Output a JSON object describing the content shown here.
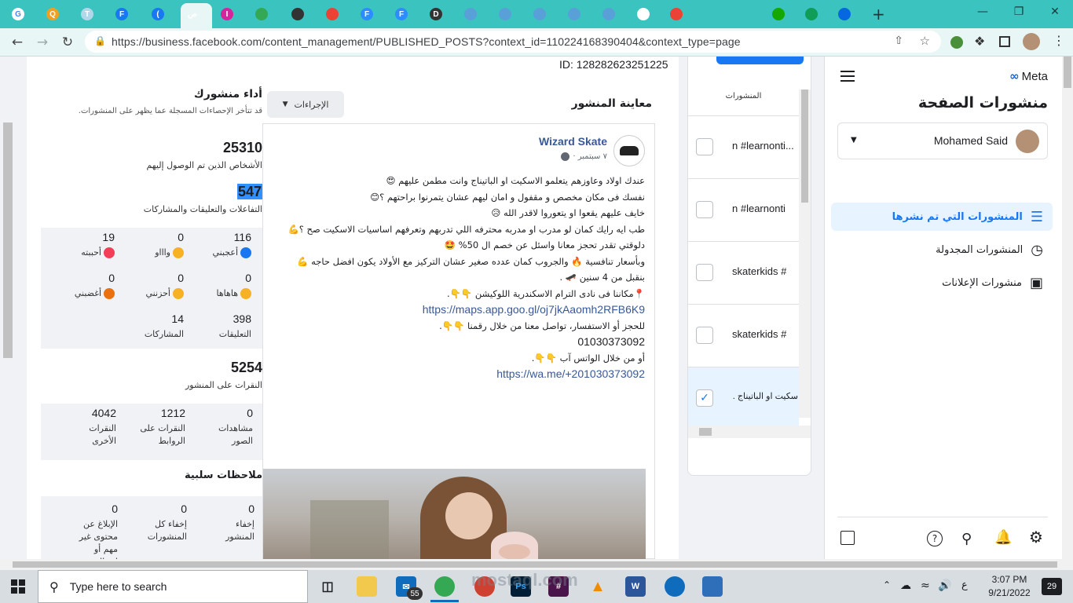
{
  "browser": {
    "tabs": [
      {
        "icon": "google-icon",
        "label": "G",
        "color": "#ffffff"
      },
      {
        "icon": "q-icon",
        "label": "Q",
        "color": "#f0a020"
      },
      {
        "icon": "t-icon",
        "label": "T",
        "color": "#b0d8e8"
      },
      {
        "icon": "facebook-icon",
        "label": "F",
        "color": "#1877f2"
      },
      {
        "icon": "facebook-icon",
        "label": "(",
        "color": "#1877f2"
      },
      {
        "icon": "meta-icon",
        "label": "ص",
        "color": "#e9f6f6"
      },
      {
        "icon": "instagram-icon",
        "label": "I",
        "color": "#d6249f"
      },
      {
        "icon": "play-store-icon",
        "label": "",
        "color": "#34a853"
      },
      {
        "icon": "globe-icon",
        "label": "",
        "color": "#333333"
      },
      {
        "icon": "gmail-icon",
        "label": "",
        "color": "#ea4335"
      },
      {
        "icon": "zoom-icon",
        "label": "F",
        "color": "#2d8cff"
      },
      {
        "icon": "zoom-icon",
        "label": "F",
        "color": "#2d8cff"
      },
      {
        "icon": "download-icon",
        "label": "D",
        "color": "#333333"
      },
      {
        "icon": "circle-icon",
        "label": "",
        "color": "#5aa0d8"
      },
      {
        "icon": "circle-icon",
        "label": "",
        "color": "#5aa0d8"
      },
      {
        "icon": "circle-icon",
        "label": "",
        "color": "#5aa0d8"
      },
      {
        "icon": "circle-icon",
        "label": "",
        "color": "#5aa0d8"
      },
      {
        "icon": "circle-icon",
        "label": "",
        "color": "#5aa0d8"
      },
      {
        "icon": "google-icon",
        "label": "",
        "color": "#ffffff"
      },
      {
        "icon": "gmail-icon",
        "label": "",
        "color": "#ea4335"
      },
      {
        "icon": "bird-icon",
        "label": "",
        "color": "#3bc3c0"
      },
      {
        "icon": "bird-icon",
        "label": "",
        "color": "#3bc3c0"
      },
      {
        "icon": "upwork-icon",
        "label": "",
        "color": "#14a800"
      },
      {
        "icon": "plus-green-icon",
        "label": "",
        "color": "#0f9d58"
      },
      {
        "icon": "meta-icon",
        "label": "",
        "color": "#0668e1"
      }
    ],
    "url": "https://business.facebook.com/content_management/PUBLISHED_POSTS?context_id=110224168390404&context_type=page"
  },
  "sidebar": {
    "brand": "Meta",
    "title": "منشورات الصفحة",
    "account": "Mohamed Said",
    "items": [
      {
        "label": "المنشورات التي تم نشرها",
        "icon": "list-icon",
        "active": true
      },
      {
        "label": "المنشورات المجدولة",
        "icon": "clock-icon",
        "active": false
      },
      {
        "label": "منشورات الإعلانات",
        "icon": "ads-icon",
        "active": false
      }
    ]
  },
  "posts_list": {
    "header": "المنشورات",
    "rows": [
      {
        "text": "n #learnonti...",
        "checked": false
      },
      {
        "text": "n #learnonti",
        "checked": false
      },
      {
        "text": "skaterkids #",
        "checked": false
      },
      {
        "text": "skaterkids #",
        "checked": false
      },
      {
        "text": "سكيت او الباتيناج ...",
        "checked": true
      }
    ]
  },
  "preview": {
    "id_label": "ID: 128282623251225",
    "title": "معاينة المنشور",
    "actions_label": "الإجراءات",
    "page_name": "Wizard Skate",
    "date": "٧ سبتمبر ·",
    "lines": [
      "عندك اولاد وعاوزهم يتعلمو الاسكيت او الباتيناج وانت مطمن عليهم 😍",
      "نفسك فى مكان مخصص و مقفول و امان ليهم عشان يتمرنوا براحتهم ؟😊",
      "خايف عليهم يقعوا او يتعوروا لاقدر الله 😥",
      "طب ايه رايك كمان لو مدرب او مدربه محترفه اللي تدربهم وتعرفهم اساسيات الاسكيت صح ؟💪",
      "دلوقتي تقدر تحجز معانا واسئل عن خصم ال 50% 🤩",
      "وبأسعار تنافسية 🔥 والجروب كمان عدده صغير عشان التركيز مع الأولاد يكون افضل حاجه 💪",
      "بنقبل من 4 سنين 🛹 .",
      "📍مكاننا فى نادى الترام الاسكندرية اللوكيشن 👇👇.",
      "https://maps.app.goo.gl/oj7jkAaomh2RFB6K9",
      "للحجز أو الاستفسار، تواصل معنا من خلال رقمنا 👇👇.",
      "01030373092",
      "أو من خلال الواتس آب 👇👇.",
      "https://wa.me/+201030373092"
    ]
  },
  "performance": {
    "title": "أداء منشورك",
    "subtitle": "قد تتأخر الإحصاءات المسجلة عما يظهر على المنشورات.",
    "reach": {
      "value": "25310",
      "label": "الأشخاص الذين تم الوصول إليهم"
    },
    "engagement": {
      "value": "547",
      "label": "التفاعلات والتعليقات والمشاركات"
    },
    "reactions": [
      {
        "value": "116",
        "label": "أعجبني",
        "icon": "like-icon",
        "color": "#1877f2"
      },
      {
        "value": "0",
        "label": "واااو",
        "icon": "wow-icon",
        "color": "#f7b125"
      },
      {
        "value": "19",
        "label": "أحببته",
        "icon": "love-icon",
        "color": "#f33e58"
      },
      {
        "value": "0",
        "label": "هاهاها",
        "icon": "haha-icon",
        "color": "#f7b125"
      },
      {
        "value": "0",
        "label": "أحزنني",
        "icon": "sad-icon",
        "color": "#f7b125"
      },
      {
        "value": "0",
        "label": "أغضبني",
        "icon": "angry-icon",
        "color": "#e9710f"
      },
      {
        "value": "398",
        "label": "التعليقات",
        "icon": "",
        "color": ""
      },
      {
        "value": "14",
        "label": "المشاركات",
        "icon": "",
        "color": ""
      }
    ],
    "clicks": {
      "value": "5254",
      "label": "النقرات على المنشور"
    },
    "click_breakdown": [
      {
        "value": "0",
        "label": "مشاهدات الصور"
      },
      {
        "value": "1212",
        "label": "النقرات على الروابط"
      },
      {
        "value": "4042",
        "label": "النقرات الأخرى"
      }
    ],
    "negative_title": "ملاحظات سلبية",
    "negative": [
      {
        "value": "0",
        "label": "إخفاء المنشور"
      },
      {
        "value": "0",
        "label": "إخفاء كل المنشورات"
      },
      {
        "value": "0",
        "label": "الإبلاغ عن محتوى غير مهم أو احتيالي"
      }
    ]
  },
  "taskbar": {
    "search_placeholder": "Type here to search",
    "mail_badge": "55",
    "lang": "ع",
    "time": "3:07 PM",
    "date": "9/21/2022",
    "notif": "29",
    "watermark": "mostaql.com"
  }
}
